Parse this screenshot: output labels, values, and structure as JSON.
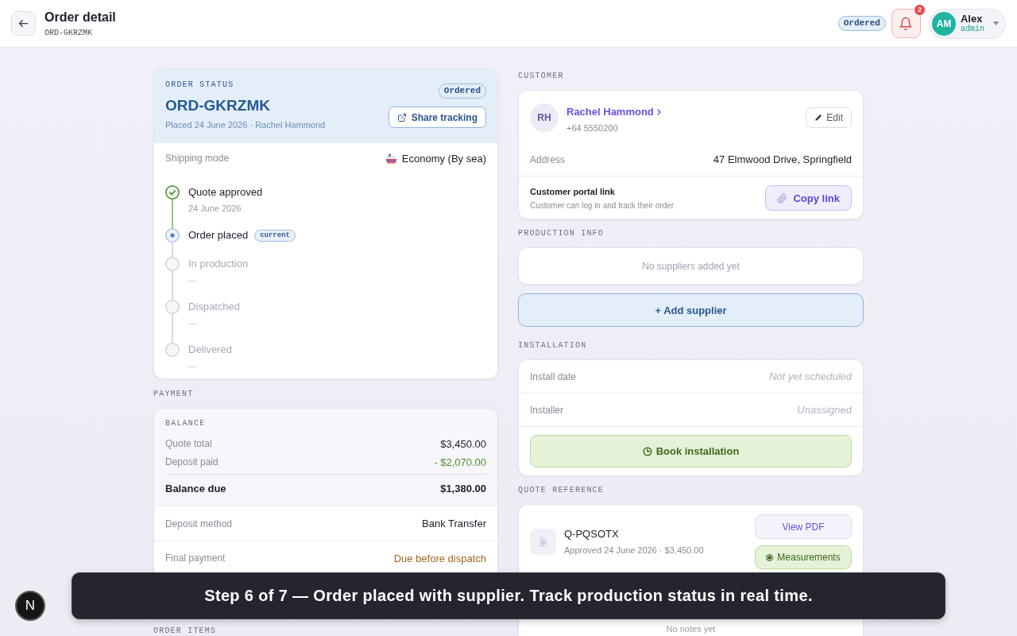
{
  "header": {
    "title": "Order detail",
    "order_ref": "ORD-GKRZMK",
    "status_badge": "Ordered",
    "notifications": {
      "count": "2"
    },
    "user": {
      "initials": "AM",
      "name": "Alex",
      "role": "admin"
    }
  },
  "order_status": {
    "section_label": "ORDER STATUS",
    "order_id": "ORD-GKRZMK",
    "meta": "Placed 24 June 2026 · Rachel Hammond",
    "badge": "Ordered",
    "share_button": "Share tracking",
    "shipping": {
      "label": "Shipping mode",
      "value": "Economy (By sea)"
    },
    "steps": [
      {
        "label": "Quote approved",
        "done": true,
        "current": false,
        "detail": "24 June 2026"
      },
      {
        "label": "Order placed",
        "done": false,
        "current": true,
        "tag": "current"
      },
      {
        "label": "In production",
        "done": false,
        "current": false,
        "detail": "—"
      },
      {
        "label": "Dispatched",
        "done": false,
        "current": false,
        "detail": "—"
      },
      {
        "label": "Delivered",
        "done": false,
        "current": false,
        "detail": "—"
      }
    ]
  },
  "payment": {
    "section_label": "PAYMENT",
    "balance": {
      "label": "BALANCE",
      "lines": [
        {
          "label": "Quote total",
          "value": "$3,450.00",
          "kind": "plain"
        },
        {
          "label": "Deposit paid",
          "value": "- $2,070.00",
          "kind": "credit"
        }
      ],
      "total": {
        "label": "Balance due",
        "value": "$1,380.00"
      }
    },
    "rows": [
      {
        "label": "Deposit method",
        "value": "Bank Transfer",
        "kind": "plain"
      },
      {
        "label": "Final payment",
        "value": "Due before dispatch",
        "kind": "pending"
      }
    ]
  },
  "order_items": {
    "section_label": "ORDER ITEMS"
  },
  "customer": {
    "section_label": "CUSTOMER",
    "initials": "RH",
    "name": "Rachel Hammond",
    "phone": "+64 5550200",
    "edit_button": "Edit",
    "address": {
      "label": "Address",
      "value": "47 Elmwood Drive, Springfield"
    },
    "portal": {
      "title": "Customer portal link",
      "description": "Customer can log in and track their order",
      "button": "Copy link"
    }
  },
  "production": {
    "section_label": "PRODUCTION INFO",
    "empty_text": "No suppliers added yet",
    "add_button": "+ Add supplier"
  },
  "installation": {
    "section_label": "INSTALLATION",
    "rows": [
      {
        "label": "Install date",
        "value": "Not yet scheduled",
        "kind": "unset"
      },
      {
        "label": "Installer",
        "value": "Unassigned",
        "kind": "unset"
      }
    ],
    "book_button": "Book installation"
  },
  "quote_reference": {
    "section_label": "QUOTE REFERENCE",
    "quote_id": "Q-PQSOTX",
    "meta": "Approved 24 June 2026 · $3,450.00",
    "buttons": [
      {
        "label": "View PDF",
        "kind": "secondary"
      },
      {
        "label": "Measurements",
        "kind": "success"
      }
    ]
  },
  "notes": {
    "empty_text": "No notes yet"
  },
  "tour": {
    "text": "Step 6 of 7 — Order placed with supplier. Track production status in real time."
  },
  "dev_badge": {
    "label": "N"
  }
}
